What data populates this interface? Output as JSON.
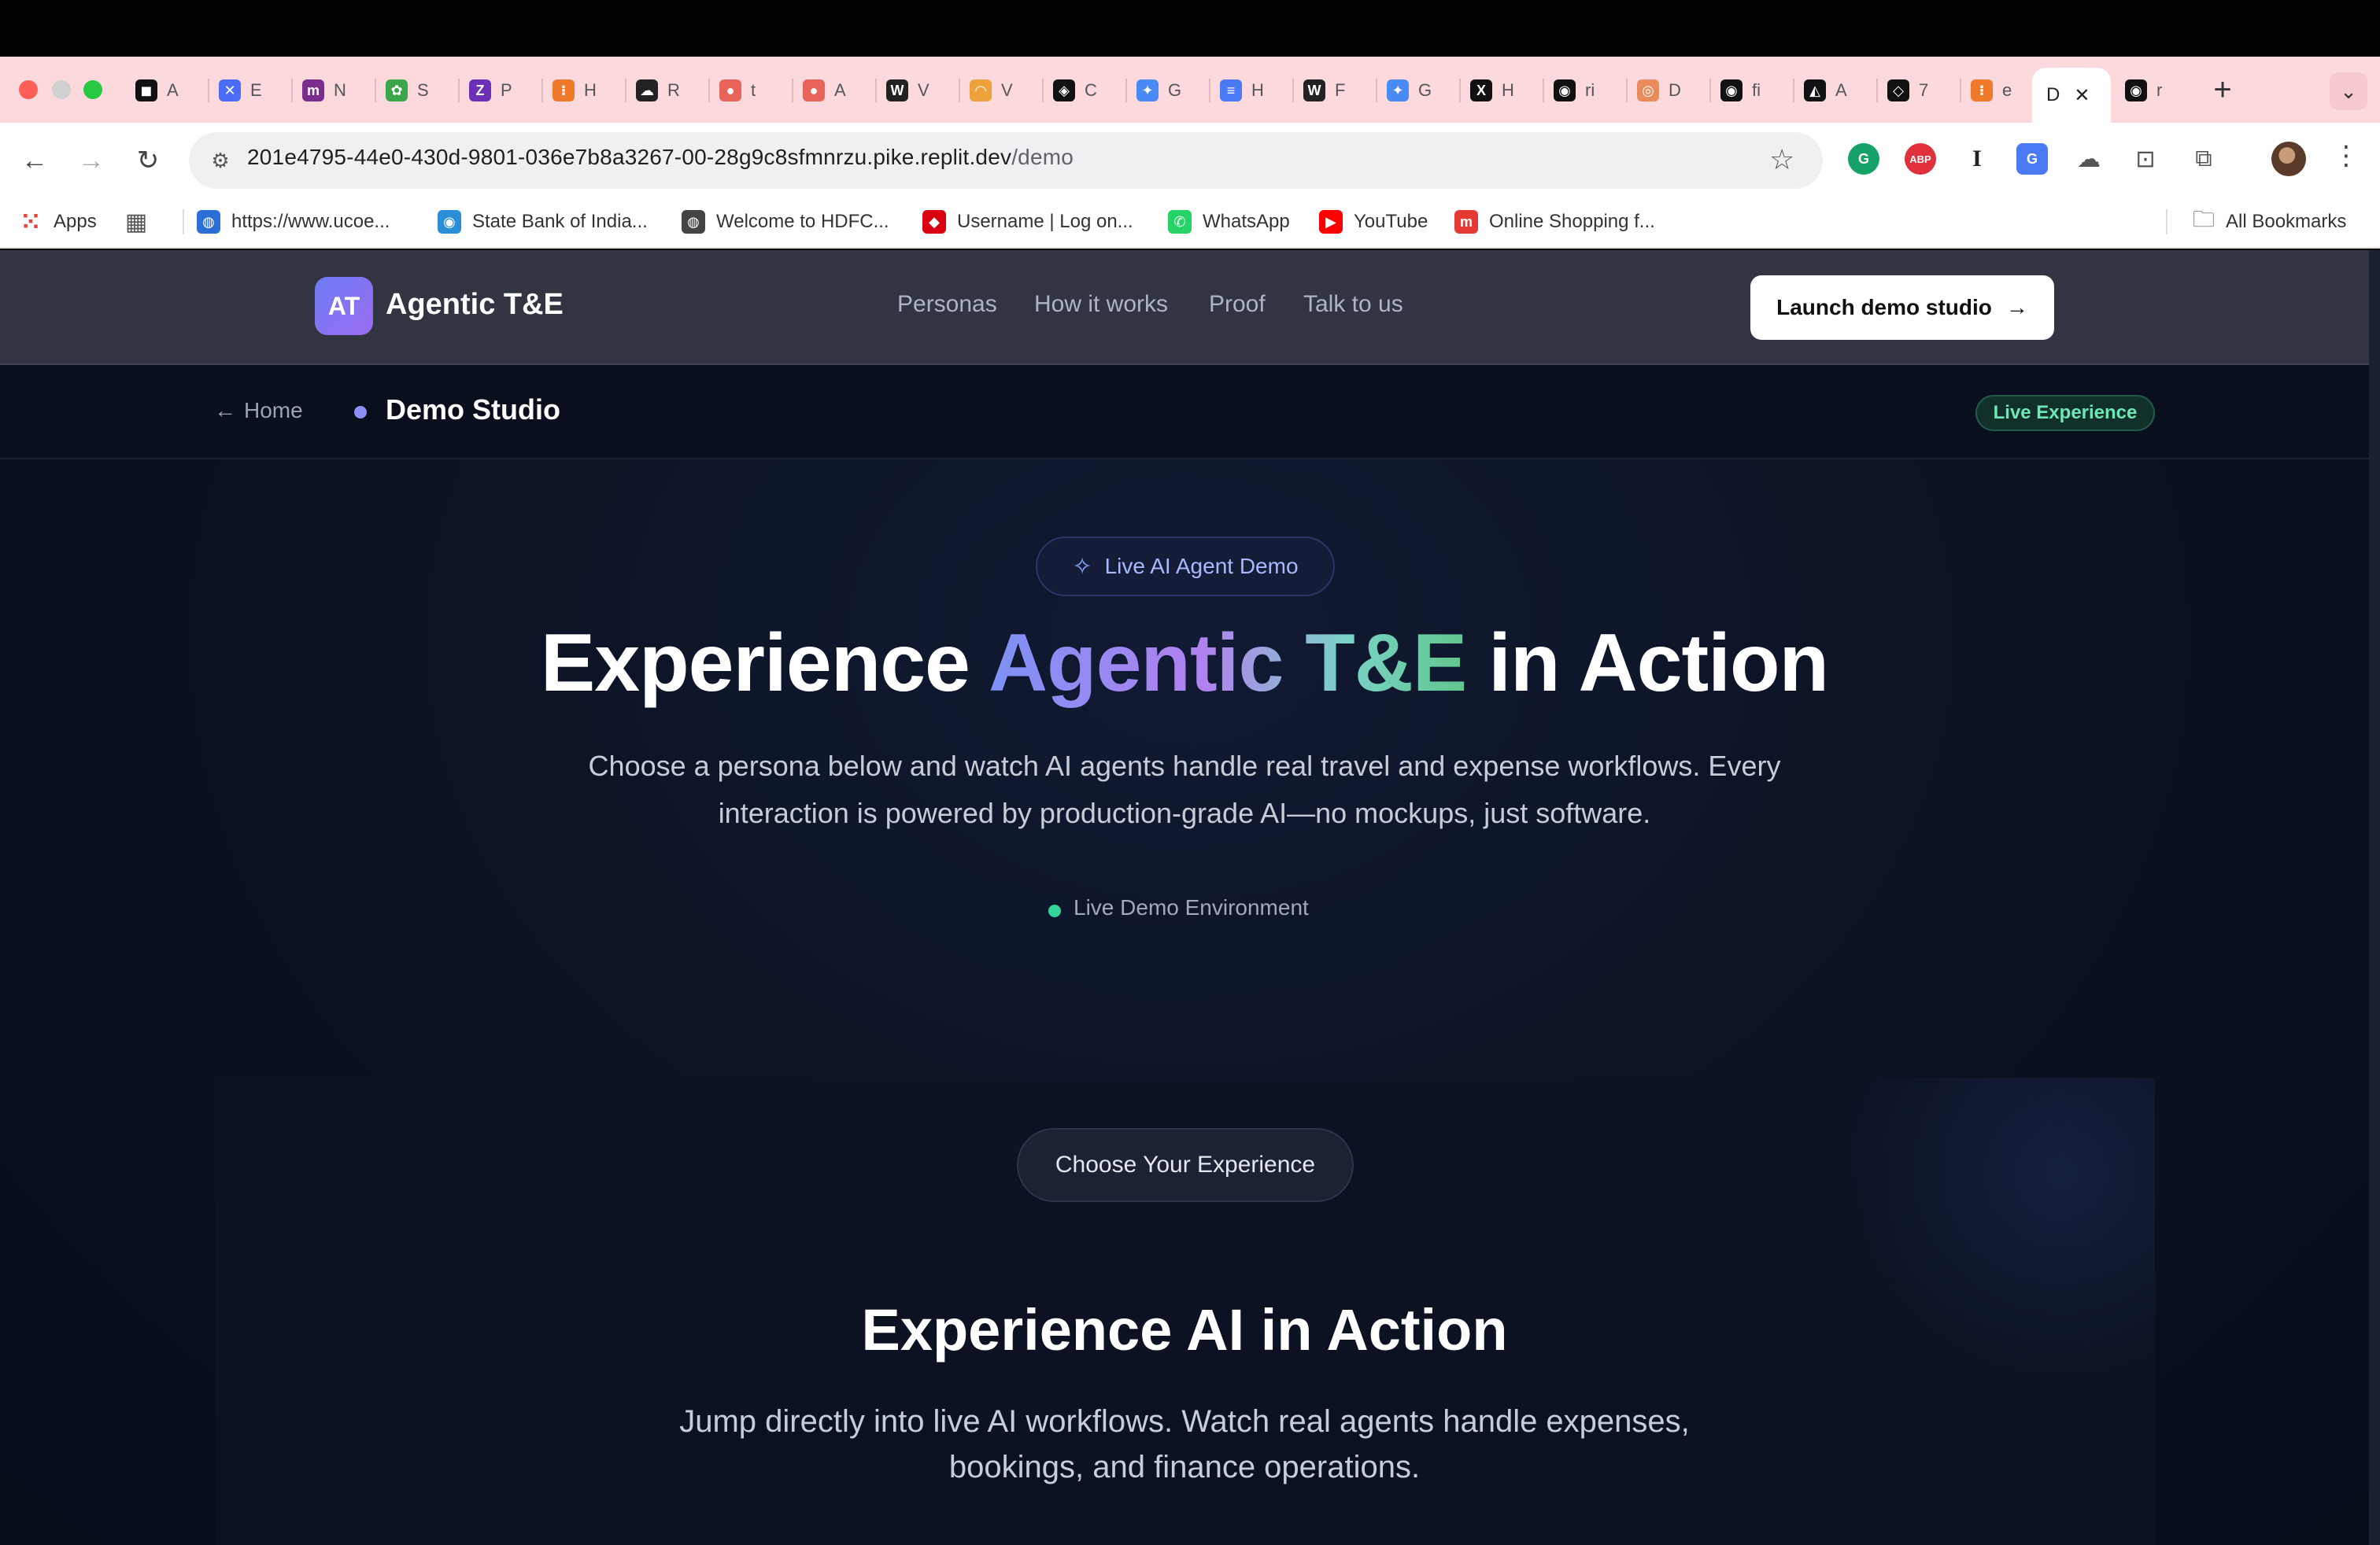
{
  "browser": {
    "tabs": [
      {
        "initial": "A",
        "color": "#111111",
        "glyph": "◼"
      },
      {
        "initial": "E",
        "color": "#4a6cf7",
        "glyph": "✕"
      },
      {
        "initial": "N",
        "color": "#7b2d8e",
        "glyph": "m"
      },
      {
        "initial": "S",
        "color": "#3aa54a",
        "glyph": "✿"
      },
      {
        "initial": "P",
        "color": "#6b2fb8",
        "glyph": "Z"
      },
      {
        "initial": "H",
        "color": "#f07a2b",
        "glyph": "⁝"
      },
      {
        "initial": "R",
        "color": "#222222",
        "glyph": "☁"
      },
      {
        "initial": "t",
        "color": "#e8645a",
        "glyph": "●"
      },
      {
        "initial": "A",
        "color": "#e8645a",
        "glyph": "●"
      },
      {
        "initial": "V",
        "color": "#222222",
        "glyph": "W"
      },
      {
        "initial": "V",
        "color": "#f0a23a",
        "glyph": "◠"
      },
      {
        "initial": "C",
        "color": "#111111",
        "glyph": "◈"
      },
      {
        "initial": "G",
        "color": "#4a8af4",
        "glyph": "✦"
      },
      {
        "initial": "H",
        "color": "#4a7af4",
        "glyph": "≡"
      },
      {
        "initial": "F",
        "color": "#222222",
        "glyph": "W"
      },
      {
        "initial": "G",
        "color": "#4a8af4",
        "glyph": "✦"
      },
      {
        "initial": "H",
        "color": "#111111",
        "glyph": "X"
      },
      {
        "initial": "ri",
        "color": "#111111",
        "glyph": "◉"
      },
      {
        "initial": "D",
        "color": "#e98b5a",
        "glyph": "◎"
      },
      {
        "initial": "fi",
        "color": "#111111",
        "glyph": "◉"
      },
      {
        "initial": "A",
        "color": "#111111",
        "glyph": "◭"
      },
      {
        "initial": "7",
        "color": "#111111",
        "glyph": "◇"
      },
      {
        "initial": "e",
        "color": "#f07a2b",
        "glyph": "⁝"
      }
    ],
    "active_tab": {
      "initial": "D",
      "close": "✕"
    },
    "last_tab": {
      "initial": "r",
      "glyph": "◉"
    },
    "new_tab": "+",
    "tab_menu": "⌄",
    "url_host": "201e4795-44e0-430d-9801-036e7b8a3267-00-28g9c8sfmnrzu.pike.replit.dev",
    "url_path": "/demo",
    "bookmarks": [
      {
        "label": "Apps",
        "icon": "apps-grid-icon",
        "color": "#e8453c"
      },
      {
        "label": "",
        "icon": "tab-groups-icon",
        "color": "#555555"
      },
      {
        "label": "https://www.ucoe...",
        "icon": "globe-icon",
        "color": "#2b6fd6"
      },
      {
        "label": "State Bank of India...",
        "icon": "sbi-icon",
        "color": "#2a8fd6"
      },
      {
        "label": "Welcome to HDFC...",
        "icon": "globe-icon",
        "color": "#444444"
      },
      {
        "label": "Username | Log on...",
        "icon": "hsbc-icon",
        "color": "#db0011"
      },
      {
        "label": "WhatsApp",
        "icon": "whatsapp-icon",
        "color": "#25d366"
      },
      {
        "label": "YouTube",
        "icon": "youtube-icon",
        "color": "#ff0000"
      },
      {
        "label": "Online Shopping f...",
        "icon": "shop-icon",
        "color": "#e53935"
      }
    ],
    "all_bookmarks": "All Bookmarks"
  },
  "site": {
    "logo": "AT",
    "brand": "Agentic T&E",
    "nav": [
      "Personas",
      "How it works",
      "Proof",
      "Talk to us"
    ],
    "cta": "Launch demo studio",
    "home": "Home",
    "section": "Demo Studio",
    "badge": "Live Experience"
  },
  "hero": {
    "pill": "Live AI Agent Demo",
    "title_pre": "Experience ",
    "title_highlight": "Agentic T&E",
    "title_post": " in Action",
    "subtitle": "Choose a persona below and watch AI agents handle real travel and expense workflows. Every interaction is powered by production-grade AI—no mockups, just software.",
    "env": "Live Demo Environment"
  },
  "panel": {
    "choose": "Choose Your Experience",
    "title": "Experience AI in Action",
    "subtitle": "Jump directly into live AI workflows. Watch real agents handle expenses, bookings, and finance operations."
  }
}
